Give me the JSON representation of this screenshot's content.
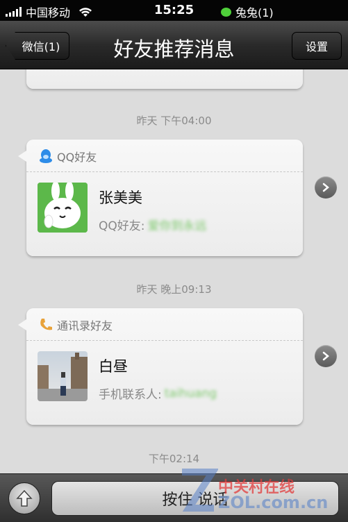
{
  "status_bar": {
    "carrier": "中国移动",
    "time": "15:25",
    "notification": "兔兔(1)"
  },
  "nav": {
    "title": "好友推荐消息",
    "back_label": "微信(1)",
    "settings_label": "设置"
  },
  "messages": [
    {
      "timestamp": "昨天 下午04:00",
      "source": "QQ好友",
      "icon": "qq-penguin-icon",
      "name": "张美美",
      "detail_label": "QQ好友:",
      "detail_value": "爱你到永远"
    },
    {
      "timestamp": "昨天 晚上09:13",
      "source": "通讯录好友",
      "icon": "phone-icon",
      "name": "白昼",
      "detail_label": "手机联系人:",
      "detail_value": "taihuang"
    }
  ],
  "next_timestamp": "下午02:14",
  "bottom_bar": {
    "talk_label": "按住 说话"
  },
  "watermark": {
    "brand": "中关村在线",
    "site": "ZOL.com.cn"
  },
  "colors": {
    "accent_green": "#4fcf3a",
    "qq_blue": "#2d8ce8",
    "phone_orange": "#e8a23a"
  }
}
